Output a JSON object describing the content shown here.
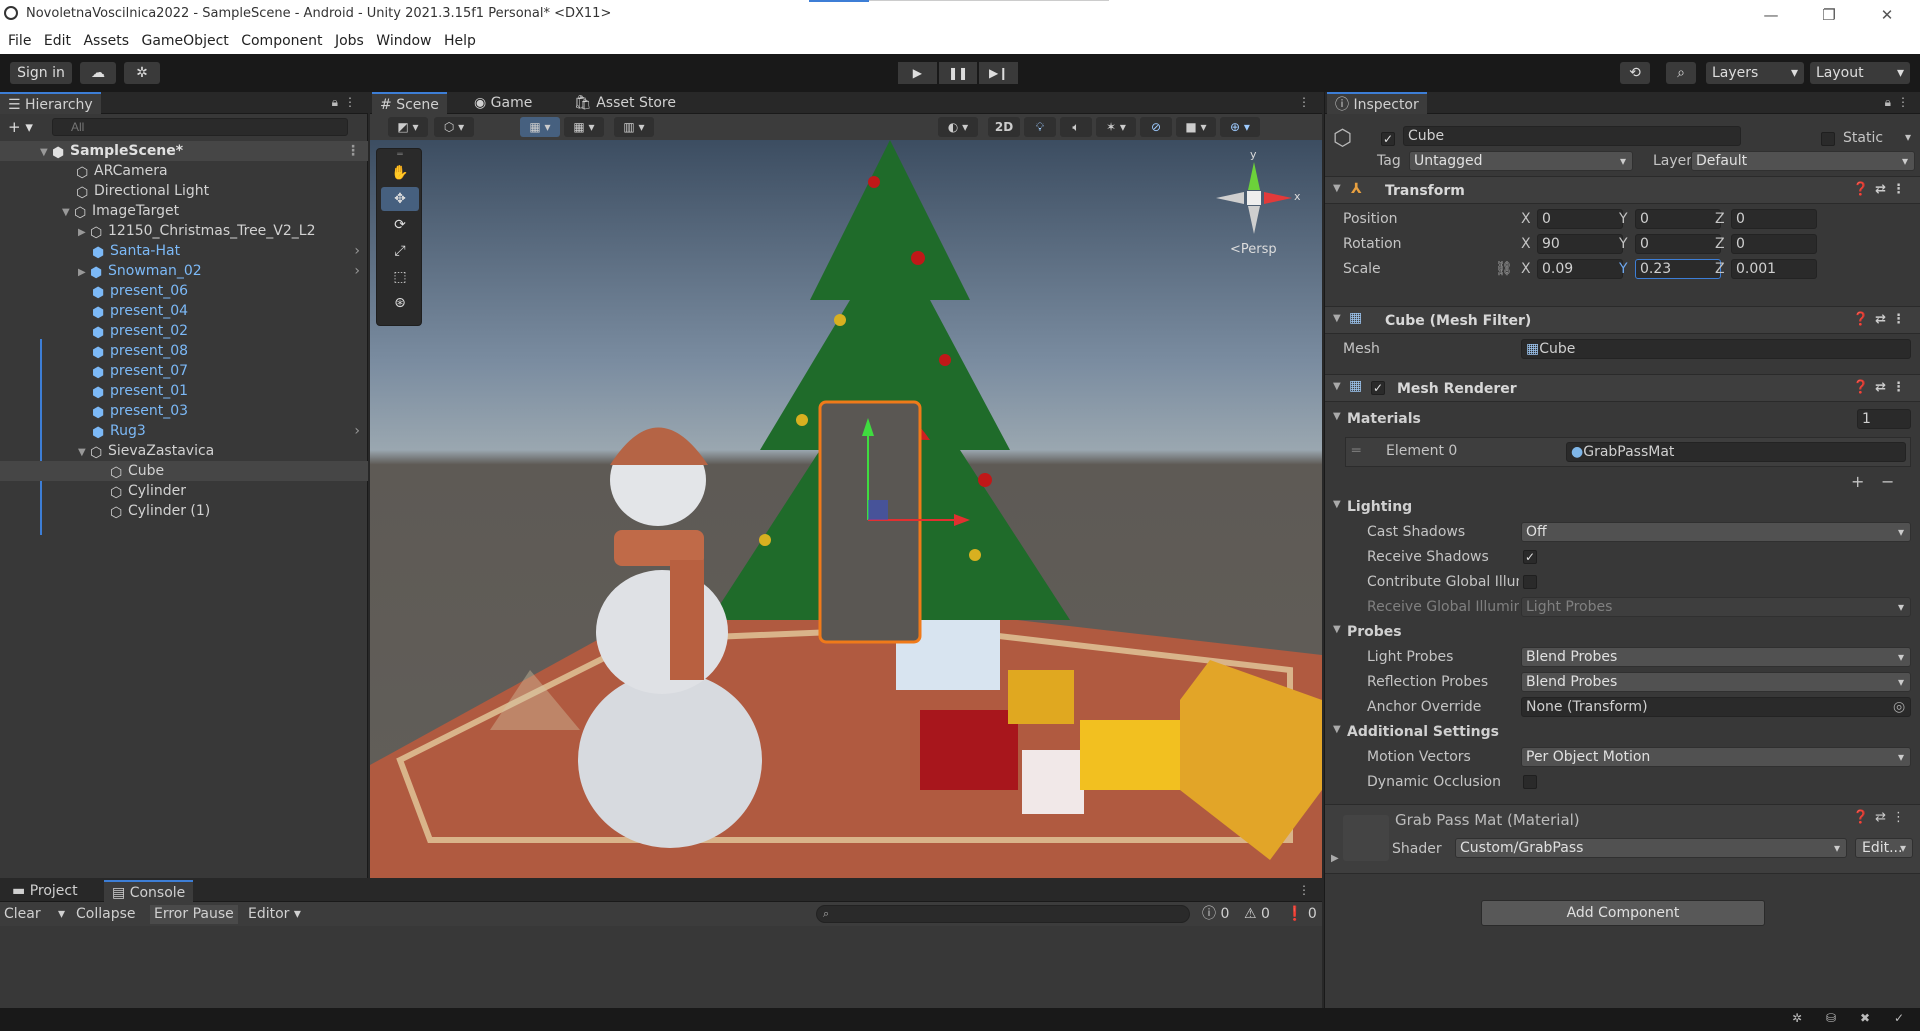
{
  "window": {
    "title": "NovoletnaVoscilnica2022 - SampleScene - Android - Unity 2021.3.15f1 Personal* <DX11>"
  },
  "menu": [
    "File",
    "Edit",
    "Assets",
    "GameObject",
    "Component",
    "Jobs",
    "Window",
    "Help"
  ],
  "toolbar": {
    "sign_in": "Sign in",
    "layers": "Layers",
    "layout": "Layout"
  },
  "hierarchy": {
    "tab": "Hierarchy",
    "search_placeholder": "All",
    "items": [
      {
        "label": "SampleScene*"
      },
      {
        "label": "ARCamera"
      },
      {
        "label": "Directional Light"
      },
      {
        "label": "ImageTarget"
      },
      {
        "label": "12150_Christmas_Tree_V2_L2"
      },
      {
        "label": "Santa-Hat"
      },
      {
        "label": "Snowman_02"
      },
      {
        "label": "present_06"
      },
      {
        "label": "present_04"
      },
      {
        "label": "present_02"
      },
      {
        "label": "present_08"
      },
      {
        "label": "present_07"
      },
      {
        "label": "present_01"
      },
      {
        "label": "present_03"
      },
      {
        "label": "Rug3"
      },
      {
        "label": "SievaZastavica"
      },
      {
        "label": "Cube"
      },
      {
        "label": "Cylinder"
      },
      {
        "label": "Cylinder (1)"
      }
    ]
  },
  "scene": {
    "tabs": [
      "Scene",
      "Game",
      "Asset Store"
    ],
    "btn_2d": "2D",
    "persp": "<Persp",
    "axis_x": "x",
    "axis_y": "y"
  },
  "bottom": {
    "tabs": [
      "Project",
      "Console"
    ],
    "clear": "Clear",
    "collapse": "Collapse",
    "error_pause": "Error Pause",
    "editor": "Editor",
    "counts": [
      "0",
      "0",
      "0"
    ]
  },
  "inspector": {
    "tab": "Inspector",
    "object_name": "Cube",
    "static_label": "Static",
    "tag_label": "Tag",
    "tag_value": "Untagged",
    "layer_label": "Layer",
    "layer_value": "Default",
    "transform": {
      "title": "Transform",
      "position_label": "Position",
      "rotation_label": "Rotation",
      "scale_label": "Scale",
      "axis_x": "X",
      "axis_y": "Y",
      "axis_z": "Z",
      "position": [
        "0",
        "0",
        "0"
      ],
      "rotation": [
        "90",
        "0",
        "0"
      ],
      "scale": [
        "0.09",
        "0.23",
        "0.001"
      ]
    },
    "mesh_filter": {
      "title": "Cube (Mesh Filter)",
      "mesh_label": "Mesh",
      "mesh_value": "Cube"
    },
    "mesh_renderer": {
      "title": "Mesh Renderer",
      "materials_label": "Materials",
      "materials_count": "1",
      "element0_label": "Element 0",
      "element0_value": "GrabPassMat",
      "lighting": "Lighting",
      "cast_shadows_label": "Cast Shadows",
      "cast_shadows_value": "Off",
      "receive_shadows_label": "Receive Shadows",
      "contribute_gi_label": "Contribute Global Illuminatic",
      "receive_gi_label": "Receive Global Illumination",
      "receive_gi_value": "Light Probes",
      "probes": "Probes",
      "light_probes_label": "Light Probes",
      "light_probes_value": "Blend Probes",
      "reflection_probes_label": "Reflection Probes",
      "reflection_probes_value": "Blend Probes",
      "anchor_override_label": "Anchor Override",
      "anchor_override_value": "None (Transform)",
      "additional": "Additional Settings",
      "motion_vectors_label": "Motion Vectors",
      "motion_vectors_value": "Per Object Motion",
      "dynamic_occlusion_label": "Dynamic Occlusion"
    },
    "material": {
      "title": "Grab Pass Mat (Material)",
      "shader_label": "Shader",
      "shader_value": "Custom/GrabPass",
      "edit": "Edit..."
    },
    "add_component": "Add Component"
  }
}
